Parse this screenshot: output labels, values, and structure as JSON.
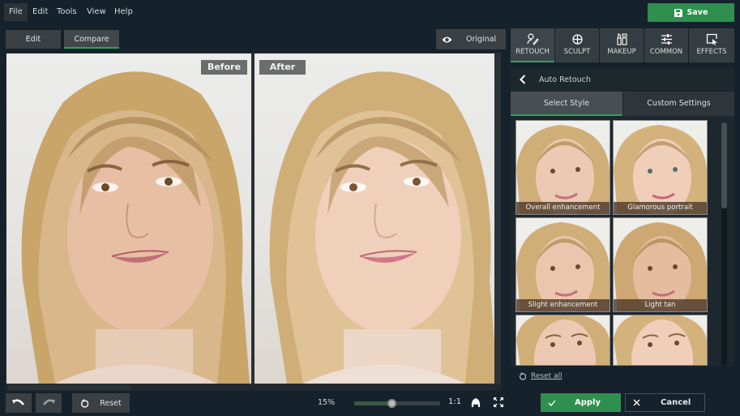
{
  "menu": {
    "items": [
      {
        "label": "File",
        "active": true
      },
      {
        "label": "Edit",
        "active": false
      },
      {
        "label": "Tools",
        "active": false
      },
      {
        "label": "View",
        "active": false
      },
      {
        "label": "Help",
        "active": false
      }
    ],
    "save_label": "Save",
    "save_icon": "floppy-disk-icon"
  },
  "view_modes": {
    "edit_label": "Edit",
    "compare_label": "Compare",
    "active": "Compare",
    "original_label": "Original",
    "original_icon": "eye-icon"
  },
  "canvas": {
    "before_label": "Before",
    "after_label": "After"
  },
  "bottom": {
    "undo_icon": "undo-icon",
    "redo_icon": "redo-icon",
    "reset_label": "Reset",
    "zoom_percent": "15%",
    "zoom_slider_value": 0.44,
    "one_to_one_label": "1:1",
    "fit_icon": "head-silhouette-icon",
    "fullscreen_icon": "fullscreen-icon"
  },
  "panel": {
    "tabs": [
      {
        "label": "RETOUCH",
        "icon": "retouch-icon",
        "active": true
      },
      {
        "label": "SCULPT",
        "icon": "sculpt-icon",
        "active": false
      },
      {
        "label": "MAKEUP",
        "icon": "makeup-icon",
        "active": false
      },
      {
        "label": "COMMON",
        "icon": "sliders-icon",
        "active": false
      },
      {
        "label": "EFFECTS",
        "icon": "effects-icon",
        "active": false
      }
    ],
    "title": "Auto Retouch",
    "subtabs": [
      {
        "label": "Select Style",
        "active": true
      },
      {
        "label": "Custom Settings",
        "active": false
      }
    ],
    "styles": [
      {
        "label": "Overall enhancement"
      },
      {
        "label": "Glamorous portrait"
      },
      {
        "label": "Slight enhancement"
      },
      {
        "label": "Light tan"
      },
      {
        "label": ""
      },
      {
        "label": ""
      }
    ],
    "reset_all_label": "Reset all",
    "apply_label": "Apply",
    "cancel_label": "Cancel"
  },
  "colors": {
    "accent_green": "#2f8f4f",
    "background": "#15222b"
  }
}
